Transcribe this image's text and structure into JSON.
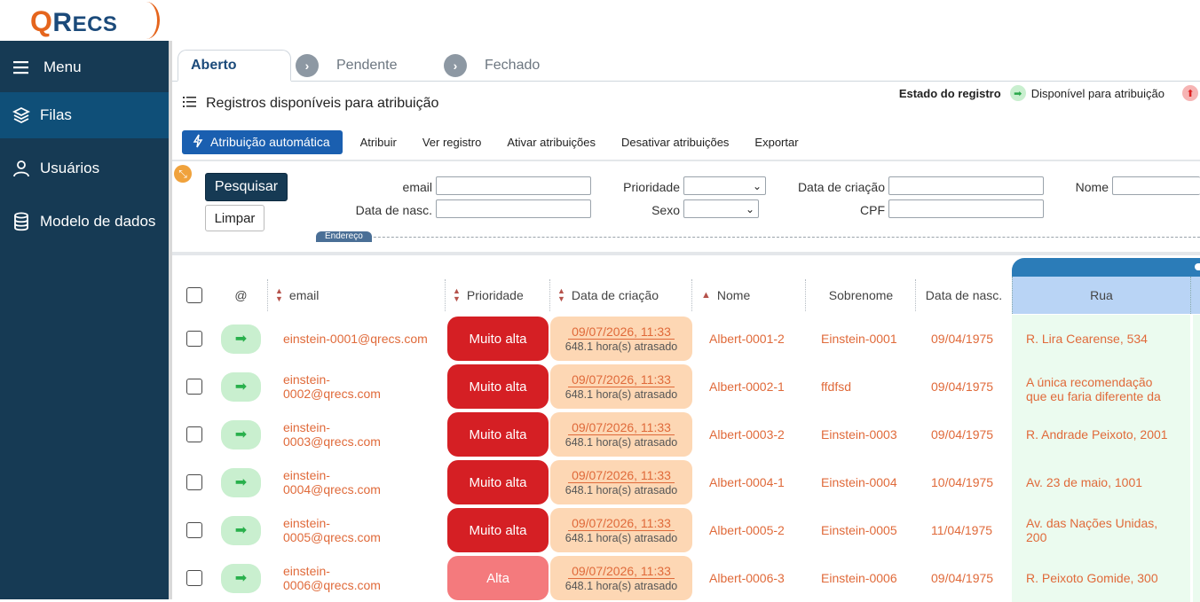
{
  "app": {
    "logo": "QRecs",
    "colors": {
      "sidebar": "#163a54",
      "accent": "#1a5fb0",
      "priority_very_high": "#d51f24",
      "priority_high": "#f47a7d",
      "available": "#c9efcf"
    }
  },
  "sidebar": {
    "menu_label": "Menu",
    "items": [
      {
        "label": "Filas",
        "icon": "layers-icon"
      },
      {
        "label": "Usuários",
        "icon": "user-icon"
      },
      {
        "label": "Modelo de dados",
        "icon": "database-icon"
      }
    ]
  },
  "tabs": [
    {
      "label": "Aberto"
    },
    {
      "label": "Pendente"
    },
    {
      "label": "Fechado"
    }
  ],
  "header": {
    "title": "Registros disponíveis para atribuição",
    "estado_label": "Estado do registro",
    "legend_available": "Disponível para atribuição"
  },
  "toolbar": {
    "auto_assign": "Atribuição automática",
    "assign": "Atribuir",
    "view": "Ver registro",
    "activate": "Ativar atribuições",
    "deactivate": "Desativar atribuições",
    "export": "Exportar"
  },
  "filters": {
    "search": "Pesquisar",
    "clear": "Limpar",
    "email": "email",
    "prioridade": "Prioridade",
    "data_criacao": "Data de criação",
    "nome": "Nome",
    "data_nasc": "Data de nasc.",
    "sexo": "Sexo",
    "cpf": "CPF",
    "endereco": "Endereço"
  },
  "columns": {
    "at": "@",
    "email": "email",
    "prioridade": "Prioridade",
    "data_criacao": "Data de criação",
    "nome": "Nome",
    "sobrenome": "Sobrenome",
    "data_nasc": "Data de nasc.",
    "rua": "Rua"
  },
  "rows": [
    {
      "email": "einstein-0001@qrecs.com",
      "prioridade": "Muito alta",
      "data": "09/07/2026, 11:33",
      "atraso": "648.1 hora(s) atrasado",
      "nome": "Albert-0001-2",
      "sobrenome": "Einstein-0001",
      "nasc": "09/04/1975",
      "rua": "R. Lira Cearense, 534"
    },
    {
      "email": "einstein-0002@qrecs.com",
      "prioridade": "Muito alta",
      "data": "09/07/2026, 11:33",
      "atraso": "648.1 hora(s) atrasado",
      "nome": "Albert-0002-1",
      "sobrenome": "ffdfsd",
      "nasc": "09/04/1975",
      "rua": "A única recomendação que eu faria diferente da"
    },
    {
      "email": "einstein-0003@qrecs.com",
      "prioridade": "Muito alta",
      "data": "09/07/2026, 11:33",
      "atraso": "648.1 hora(s) atrasado",
      "nome": "Albert-0003-2",
      "sobrenome": "Einstein-0003",
      "nasc": "09/04/1975",
      "rua": "R. Andrade Peixoto, 2001"
    },
    {
      "email": "einstein-0004@qrecs.com",
      "prioridade": "Muito alta",
      "data": "09/07/2026, 11:33",
      "atraso": "648.1 hora(s) atrasado",
      "nome": "Albert-0004-1",
      "sobrenome": "Einstein-0004",
      "nasc": "10/04/1975",
      "rua": "Av. 23 de maio, 1001"
    },
    {
      "email": "einstein-0005@qrecs.com",
      "prioridade": "Muito alta",
      "data": "09/07/2026, 11:33",
      "atraso": "648.1 hora(s) atrasado",
      "nome": "Albert-0005-2",
      "sobrenome": "Einstein-0005",
      "nasc": "11/04/1975",
      "rua": "Av. das Nações Unidas, 200"
    },
    {
      "email": "einstein-0006@qrecs.com",
      "prioridade": "Alta",
      "data": "09/07/2026, 11:33",
      "atraso": "648.1 hora(s) atrasado",
      "nome": "Albert-0006-3",
      "sobrenome": "Einstein-0006",
      "nasc": "09/04/1975",
      "rua": "R. Peixoto Gomide, 300"
    }
  ]
}
